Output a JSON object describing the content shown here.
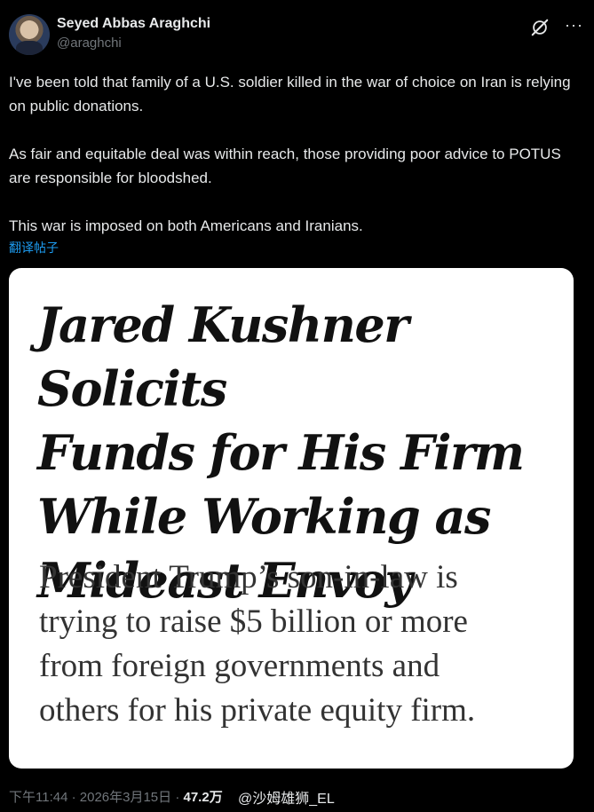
{
  "author": {
    "name": "Seyed Abbas Araghchi",
    "handle": "@araghchi"
  },
  "icons": {
    "grok": "grok-icon",
    "more": "more-icon",
    "more_glyph": "···"
  },
  "tweet": {
    "paragraphs": [
      "I've been told that family of a U.S. soldier killed in the war of choice on Iran is relying on public donations.",
      "As fair and equitable deal was within reach, those providing poor advice to POTUS are responsible for bloodshed.",
      "This war is imposed on both Americans and Iranians."
    ],
    "translate_link": "翻译帖子"
  },
  "card": {
    "headline": "Jared Kushner Solicits\nFunds for His Firm\nWhile Working as\nMideast Envoy",
    "subhead": "President Trump’s son-in-law is\ntrying to raise $5 billion or more\nfrom foreign governments and\nothers for his private equity firm."
  },
  "footer": {
    "timestamp": "下午11:44 · 2026年3月15日 ·",
    "views": "47.2万",
    "watermark": "@沙姆雄狮_EL"
  },
  "colors": {
    "background": "#000000",
    "text": "#e7e9ea",
    "secondary": "#71767b",
    "link": "#1d9bf0"
  }
}
